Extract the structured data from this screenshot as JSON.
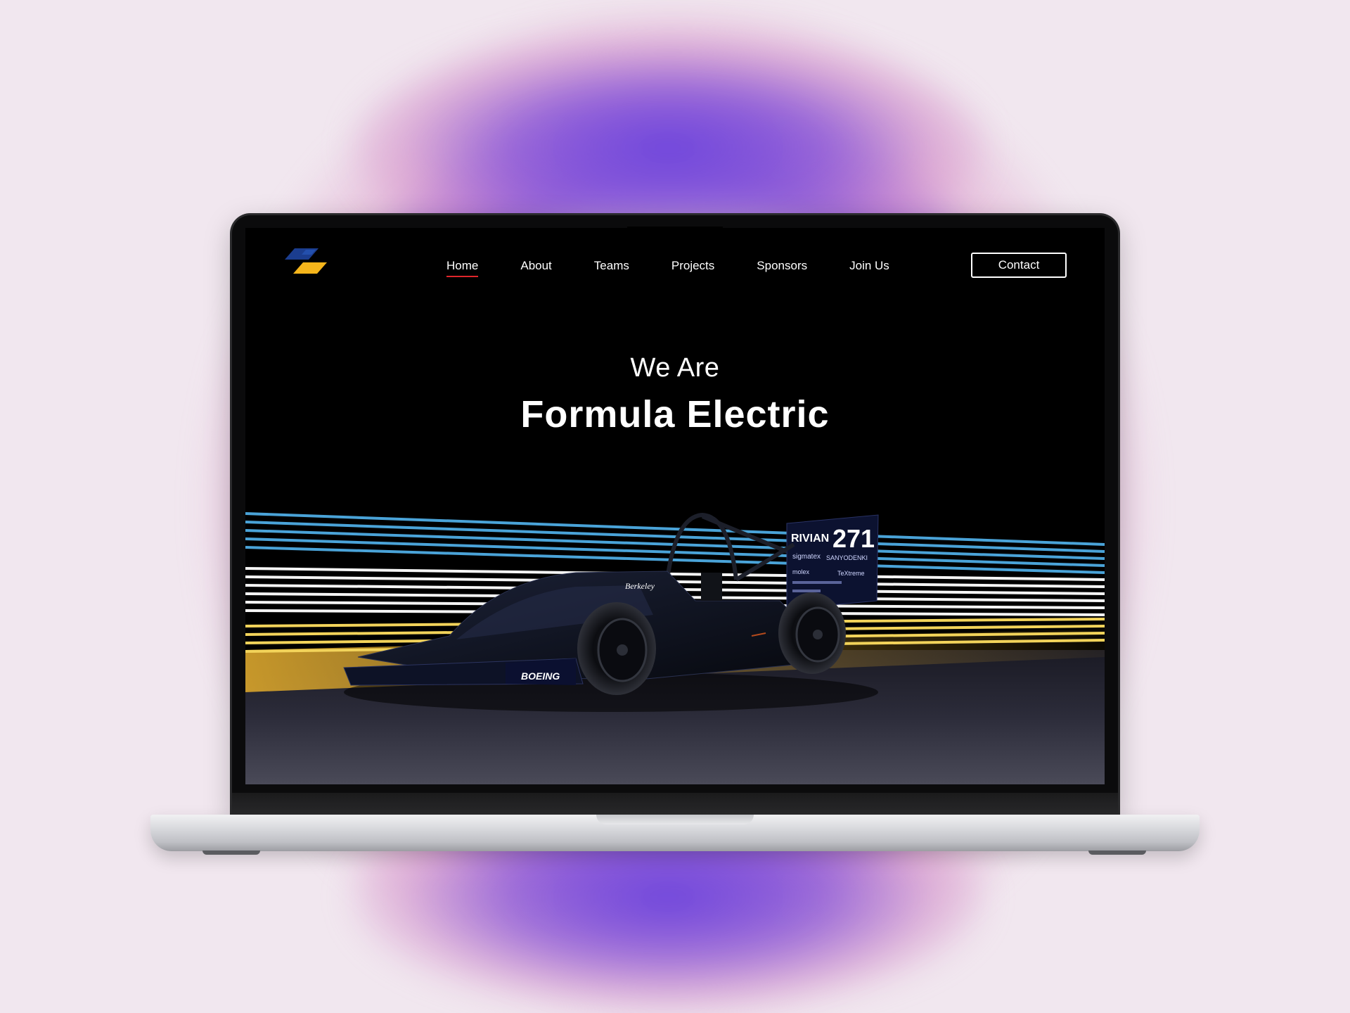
{
  "nav": {
    "items": [
      {
        "label": "Home",
        "active": true
      },
      {
        "label": "About",
        "active": false
      },
      {
        "label": "Teams",
        "active": false
      },
      {
        "label": "Projects",
        "active": false
      },
      {
        "label": "Sponsors",
        "active": false
      },
      {
        "label": "Join Us",
        "active": false
      }
    ],
    "contact_label": "Contact",
    "active_underline_color": "#e0262b"
  },
  "hero": {
    "pre_title": "We Are",
    "title": "Formula Electric"
  },
  "car": {
    "number": "271",
    "sponsor_main": "RIVIAN",
    "sponsor_small": [
      "sigmatex",
      "SANYODENKI",
      "molex",
      "TeXtreme",
      "Berkeley"
    ],
    "front_wing_sponsor": "BOEING"
  },
  "colors": {
    "logo_blue": "#1b3d8f",
    "logo_yellow": "#f5b51b",
    "stripe_blue": "#4aa3d8",
    "stripe_white": "#f4f4f4",
    "stripe_yellow": "#f2d35a",
    "background": "#000000"
  },
  "icons": {
    "logo": "team-logo-icon"
  }
}
